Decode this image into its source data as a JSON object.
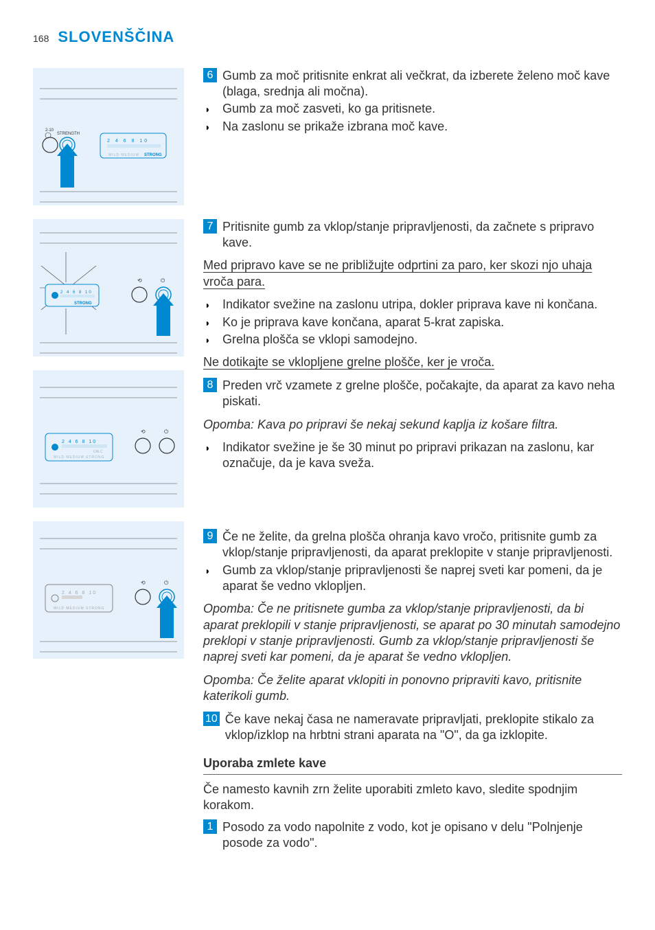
{
  "page_number": "168",
  "language_heading": "SLOVENŠČINA",
  "steps": {
    "s6": {
      "num": "6",
      "text": "Gumb za moč pritisnite enkrat ali večkrat, da izberete želeno moč kave (blaga, srednja ali močna).",
      "bullets": [
        "Gumb za moč zasveti, ko ga pritisnete.",
        "Na zaslonu se prikaže izbrana moč kave."
      ]
    },
    "s7": {
      "num": "7",
      "text": "Pritisnite gumb za vklop/stanje pripravljenosti, da začnete s pripravo kave.",
      "warning": "Med pripravo kave se ne približujte odprtini za paro, ker skozi njo uhaja vroča para.",
      "bullets": [
        "Indikator svežine na zaslonu utripa, dokler priprava kave ni končana.",
        "Ko je priprava kave končana, aparat 5-krat zapiska.",
        "Grelna plošča se vklopi samodejno."
      ],
      "warning2": "Ne dotikajte se vklopljene grelne plošče, ker je vroča."
    },
    "s8": {
      "num": "8",
      "text": "Preden vrč vzamete z grelne plošče, počakajte, da aparat za kavo neha piskati.",
      "note": "Opomba: Kava po pripravi še nekaj sekund kaplja iz košare filtra.",
      "bullets": [
        "Indikator svežine je še 30 minut po pripravi prikazan na zaslonu, kar označuje, da je kava sveža."
      ]
    },
    "s9": {
      "num": "9",
      "text": "Če ne želite, da grelna plošča ohranja kavo vročo, pritisnite gumb za vklop/stanje pripravljenosti, da aparat preklopite v stanje pripravljenosti.",
      "bullets": [
        "Gumb za vklop/stanje pripravljenosti še naprej sveti kar pomeni, da je aparat še vedno vklopljen."
      ],
      "note1": "Opomba: Če ne pritisnete gumba za vklop/stanje pripravljenosti, da bi aparat preklopili v stanje pripravljenosti, se aparat po 30 minutah samodejno preklopi v stanje pripravljenosti. Gumb za vklop/stanje pripravljenosti še naprej sveti kar pomeni, da je aparat še vedno vklopljen.",
      "note2": "Opomba: Če želite aparat vklopiti in ponovno pripraviti kavo, pritisnite katerikoli gumb."
    },
    "s10": {
      "num": "10",
      "text": "Če kave nekaj časa ne nameravate pripravljati, preklopite stikalo za vklop/izklop na hrbtni strani aparata na \"O\", da ga izklopite."
    }
  },
  "section2": {
    "heading": "Uporaba zmlete kave",
    "intro": "Če namesto kavnih zrn želite uporabiti zmleto kavo, sledite spodnjim korakom.",
    "s1": {
      "num": "1",
      "text": "Posodo za vodo napolnite z vodo, kot je opisano v delu \"Polnjenje posode za vodo\"."
    }
  },
  "illus": {
    "strength_label": "STRENGTH",
    "cups_label": "2-10",
    "scale": "2  4  6  8  10",
    "calc": "CALC",
    "modes": "MILD  MEDIUM  STRONG",
    "strong": "STRONG"
  }
}
